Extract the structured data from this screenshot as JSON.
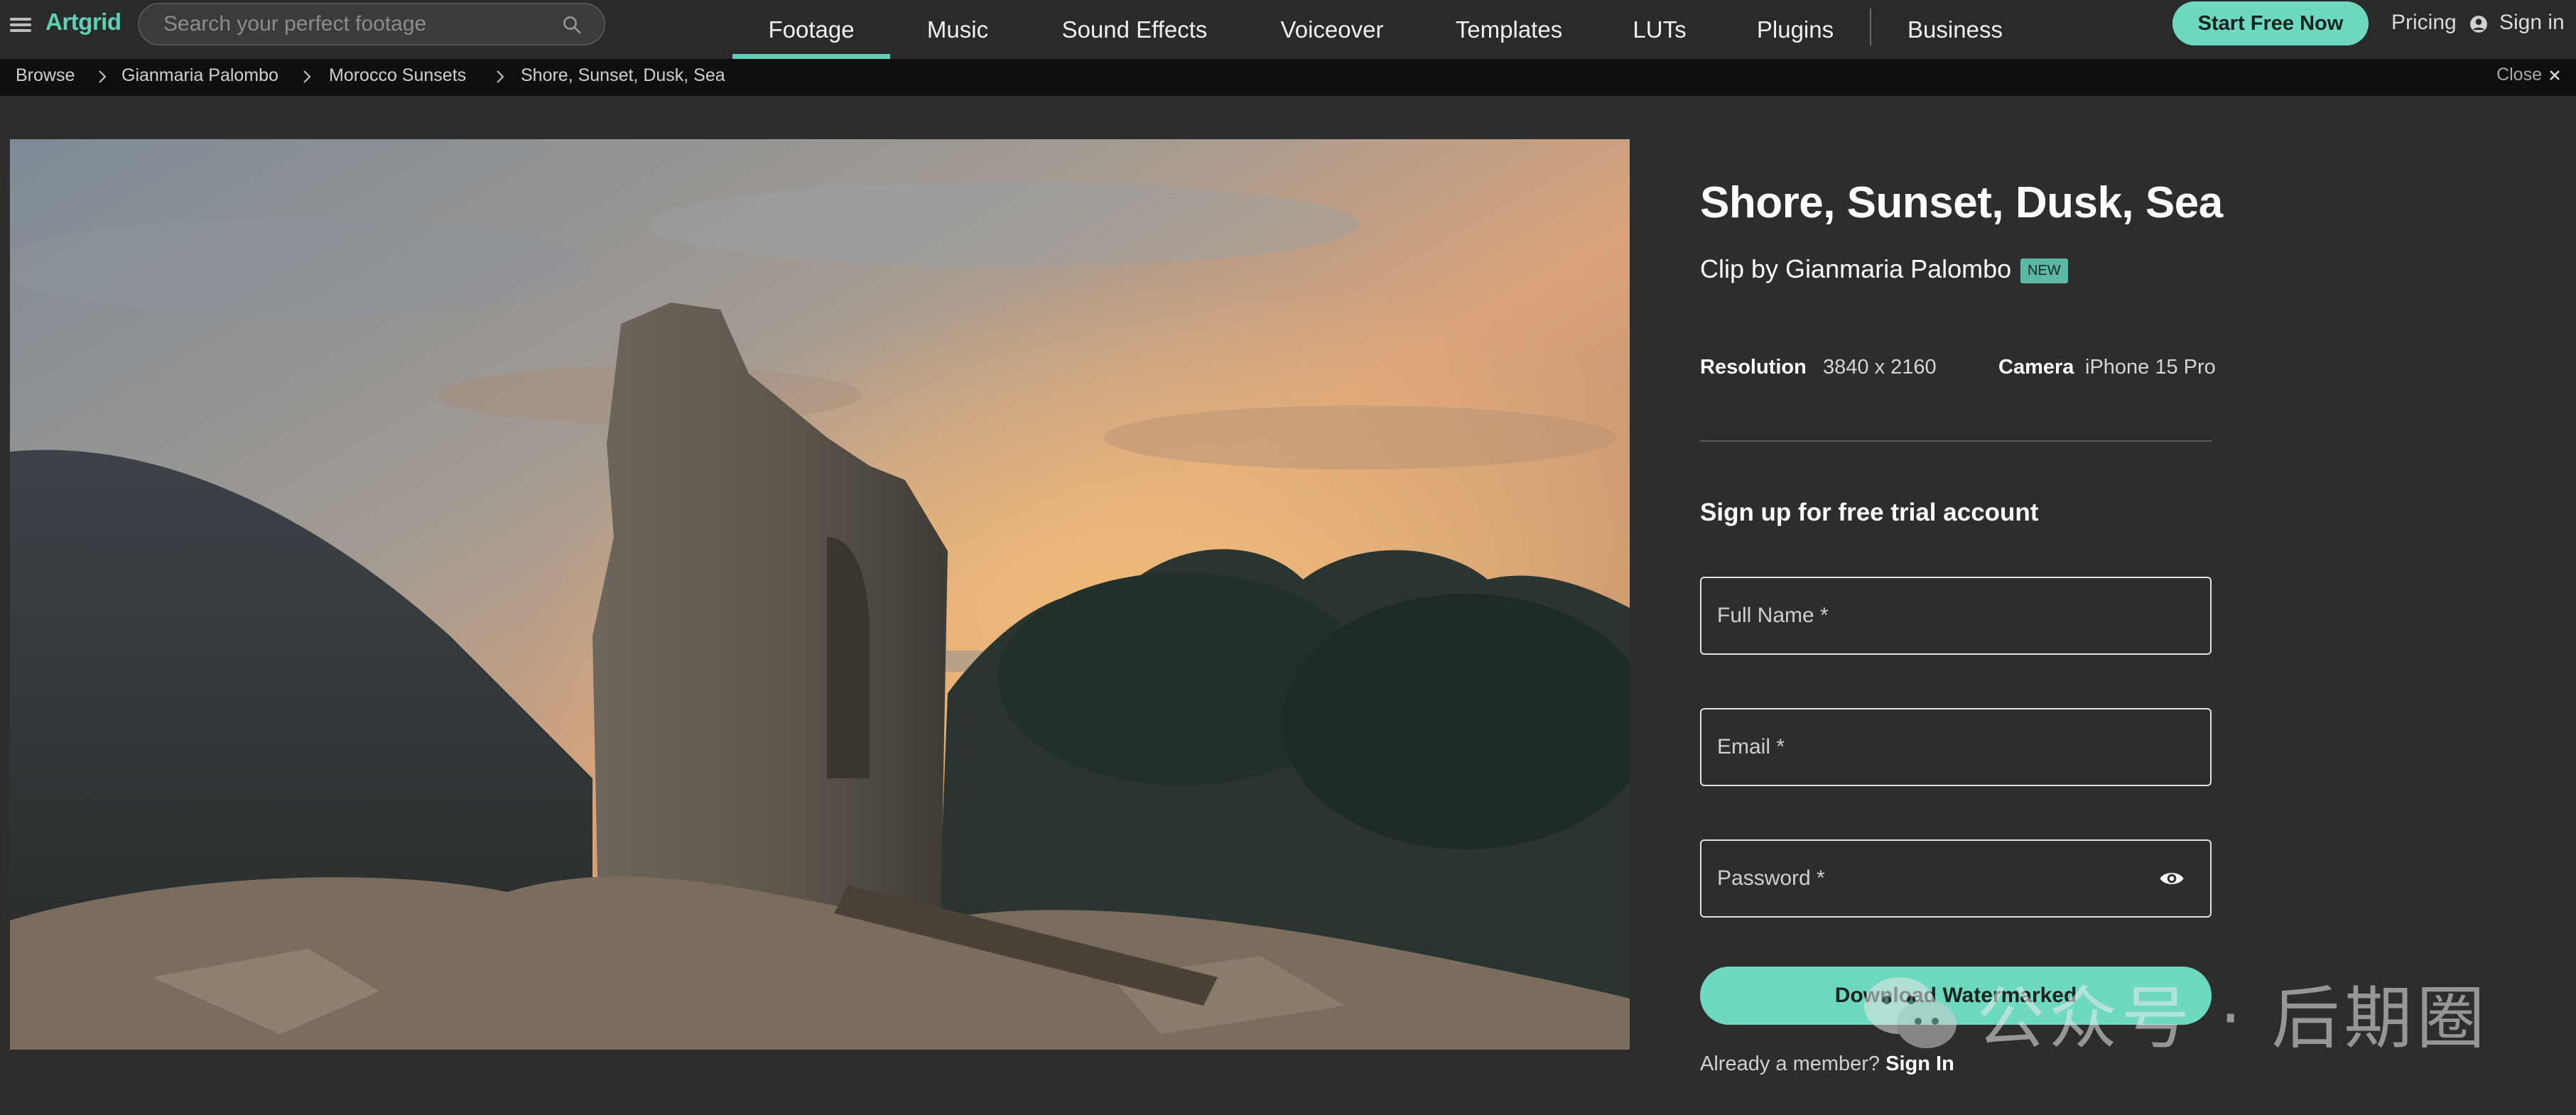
{
  "nav": {
    "logo": "Artgrid",
    "search_placeholder": "Search your perfect footage",
    "tabs": [
      {
        "label": "Footage"
      },
      {
        "label": "Music"
      },
      {
        "label": "Sound Effects"
      },
      {
        "label": "Voiceover"
      },
      {
        "label": "Templates"
      },
      {
        "label": "LUTs"
      },
      {
        "label": "Plugins"
      },
      {
        "label": "Business"
      }
    ],
    "active_tab": "Footage",
    "cta": "Start Free Now",
    "pricing": "Pricing",
    "sign_in": "Sign in"
  },
  "breadcrumb": {
    "items": [
      "Browse",
      "Gianmaria Palombo",
      "Morocco Sunsets",
      "Shore, Sunset, Dusk, Sea"
    ],
    "close": "Close"
  },
  "clip": {
    "title": "Shore, Sunset, Dusk, Sea",
    "byline": "Clip by Gianmaria Palombo",
    "badge": "NEW",
    "resolution_label": "Resolution",
    "resolution_value": "3840 x 2160",
    "camera_label": "Camera",
    "camera_value": "iPhone 15 Pro"
  },
  "signup": {
    "heading": "Sign up for free trial account",
    "full_name_placeholder": "Full Name *",
    "email_placeholder": "Email *",
    "password_placeholder": "Password *",
    "download_button": "Download Watermarked",
    "member_text": "Already a member?",
    "member_link": "Sign In"
  },
  "watermark": {
    "text": "公众号 · 后期圈"
  },
  "colors": {
    "accent": "#6fd9c0",
    "logo": "#5fd0b6",
    "background": "#2d2d2d",
    "nav_background": "#2a2a2a",
    "breadcrumb_background": "#0f0f0f"
  }
}
